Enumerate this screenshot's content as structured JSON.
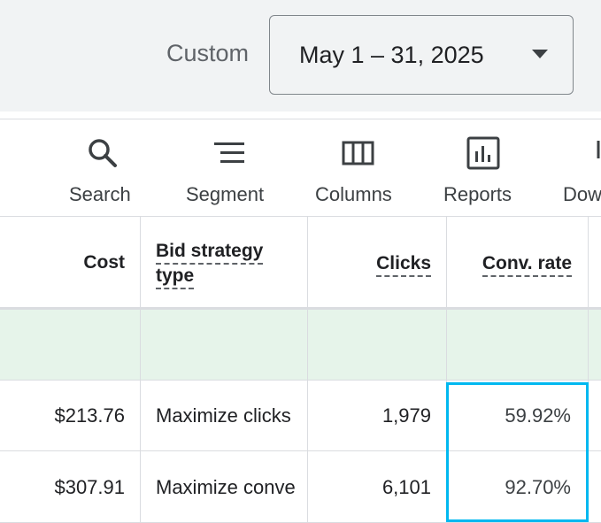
{
  "date_range": {
    "label": "Custom",
    "value": "May 1 – 31, 2025"
  },
  "toolbar": {
    "items": [
      {
        "label": "Search",
        "icon": "search-icon"
      },
      {
        "label": "Segment",
        "icon": "segment-icon"
      },
      {
        "label": "Columns",
        "icon": "columns-icon"
      },
      {
        "label": "Reports",
        "icon": "reports-icon"
      },
      {
        "label": "Dow",
        "icon": "download-icon"
      }
    ]
  },
  "table": {
    "headers": {
      "cost": "Cost",
      "bid_strategy_line1": "Bid strategy",
      "bid_strategy_line2": "type",
      "clicks": "Clicks",
      "conv_rate": "Conv. rate"
    },
    "rows": [
      {
        "cost": "$213.76",
        "bid_strategy": "Maximize clicks",
        "clicks": "1,979",
        "conv_rate": "59.92%"
      },
      {
        "cost": "$307.91",
        "bid_strategy": "Maximize conve",
        "clicks": "6,101",
        "conv_rate": "92.70%"
      }
    ]
  },
  "colors": {
    "highlight_border": "#00b8f0",
    "green_row": "#e6f4ea"
  }
}
